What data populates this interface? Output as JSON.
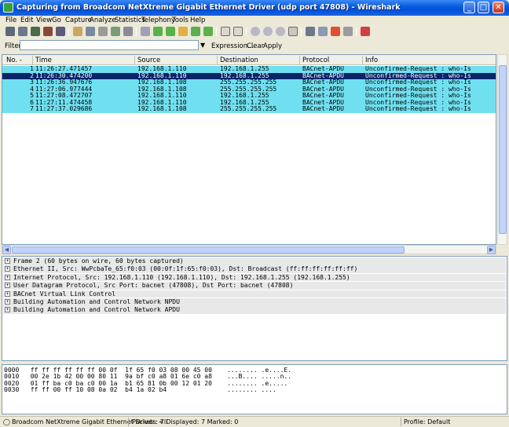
{
  "window": {
    "title": "Capturing from Broadcom NetXtreme Gigabit Ethernet Driver (udp port 47808) - Wireshark",
    "controls": [
      "_",
      "□",
      "✕"
    ]
  },
  "menu": [
    "File",
    "Edit",
    "View",
    "Go",
    "Capture",
    "Analyze",
    "Statistics",
    "Telephony",
    "Tools",
    "Help"
  ],
  "toolbar": {
    "icons": [
      "interface-list-icon",
      "capture-options-icon",
      "start-capture-icon",
      "stop-capture-icon",
      "restart-capture-icon",
      "open-file-icon",
      "save-file-icon",
      "close-file-icon",
      "reload-icon",
      "print-icon",
      "find-icon",
      "go-back-icon",
      "go-forward-icon",
      "go-to-packet-icon",
      "go-first-icon",
      "go-last-icon",
      "colorize-icon",
      "auto-scroll-icon",
      "zoom-in-icon",
      "zoom-out-icon",
      "zoom-normal-icon",
      "resize-columns-icon",
      "capture-filters-icon",
      "display-filters-icon",
      "coloring-rules-icon",
      "preferences-icon",
      "help-icon"
    ]
  },
  "filter": {
    "label": "Filter:",
    "value": "",
    "expression": "Expression...",
    "clear": "Clear",
    "apply": "Apply"
  },
  "packet_list": {
    "columns": [
      "No. -",
      "Time",
      "Source",
      "Destination",
      "Protocol",
      "Info"
    ],
    "rows": [
      {
        "no": "1",
        "time": "11:26:27.471457",
        "src": "192.168.1.110",
        "dst": "192.168.1.255",
        "proto": "BACnet-APDU",
        "info": "Unconfirmed-Request : who-Is",
        "selected": false
      },
      {
        "no": "2",
        "time": "11:26:30.474200",
        "src": "192.168.1.110",
        "dst": "192.168.1.255",
        "proto": "BACnet-APDU",
        "info": "Unconfirmed-Request : who-Is",
        "selected": true
      },
      {
        "no": "3",
        "time": "11:26:36.947676",
        "src": "192.168.1.108",
        "dst": "255.255.255.255",
        "proto": "BACnet-APDU",
        "info": "Unconfirmed-Request : who-Is",
        "selected": false
      },
      {
        "no": "4",
        "time": "11:27:06.977444",
        "src": "192.168.1.108",
        "dst": "255.255.255.255",
        "proto": "BACnet-APDU",
        "info": "Unconfirmed-Request : who-Is",
        "selected": false
      },
      {
        "no": "5",
        "time": "11:27:08.472707",
        "src": "192.168.1.110",
        "dst": "192.168.1.255",
        "proto": "BACnet-APDU",
        "info": "Unconfirmed-Request : who-Is",
        "selected": false
      },
      {
        "no": "6",
        "time": "11:27:11.474458",
        "src": "192.168.1.110",
        "dst": "192.168.1.255",
        "proto": "BACnet-APDU",
        "info": "Unconfirmed-Request : who-Is",
        "selected": false
      },
      {
        "no": "7",
        "time": "11:27:37.029686",
        "src": "192.168.1.108",
        "dst": "255.255.255.255",
        "proto": "BACnet-APDU",
        "info": "Unconfirmed-Request : who-Is",
        "selected": false
      }
    ]
  },
  "details": [
    "Frame 2 (60 bytes on wire, 60 bytes captured)",
    "Ethernet II, Src: WwPcbaTe_65:f0:03 (00:0f:1f:65:f0:03), Dst: Broadcast (ff:ff:ff:ff:ff:ff)",
    "Internet Protocol, Src: 192.168.1.110 (192.168.1.110), Dst: 192.168.1.255 (192.168.1.255)",
    "User Datagram Protocol, Src Port: bacnet (47808), Dst Port: bacnet (47808)",
    "BACnet Virtual Link Control",
    "Building Automation and Control Network NPDU",
    "Building Automation and Control Network APDU"
  ],
  "hex": [
    "0000   ff ff ff ff ff ff 00 0f  1f 65 f0 03 08 00 45 00    ........ .e....E.",
    "0010   00 2e 1b 42 00 00 80 11  9a bf c0 a8 01 6e c0 a8    ...B.... .....n..",
    "0020   01 ff ba c0 ba c0 00 1a  b1 65 81 0b 00 12 01 20    ........ .e..... ",
    "0030   ff ff 00 ff 10 08 0a 02  b4 1a 02 b4                ........ ...."
  ],
  "status": {
    "interface": "Broadcom NetXtreme Gigabit Ethernet Driver: <li",
    "packets": "Packets: 7 Displayed: 7 Marked: 0",
    "profile": "Profile: Default"
  },
  "colors": {
    "row_bg": "#70e0f0",
    "row_selected": "#0a246a",
    "titlebar": "#0a5ce0"
  }
}
